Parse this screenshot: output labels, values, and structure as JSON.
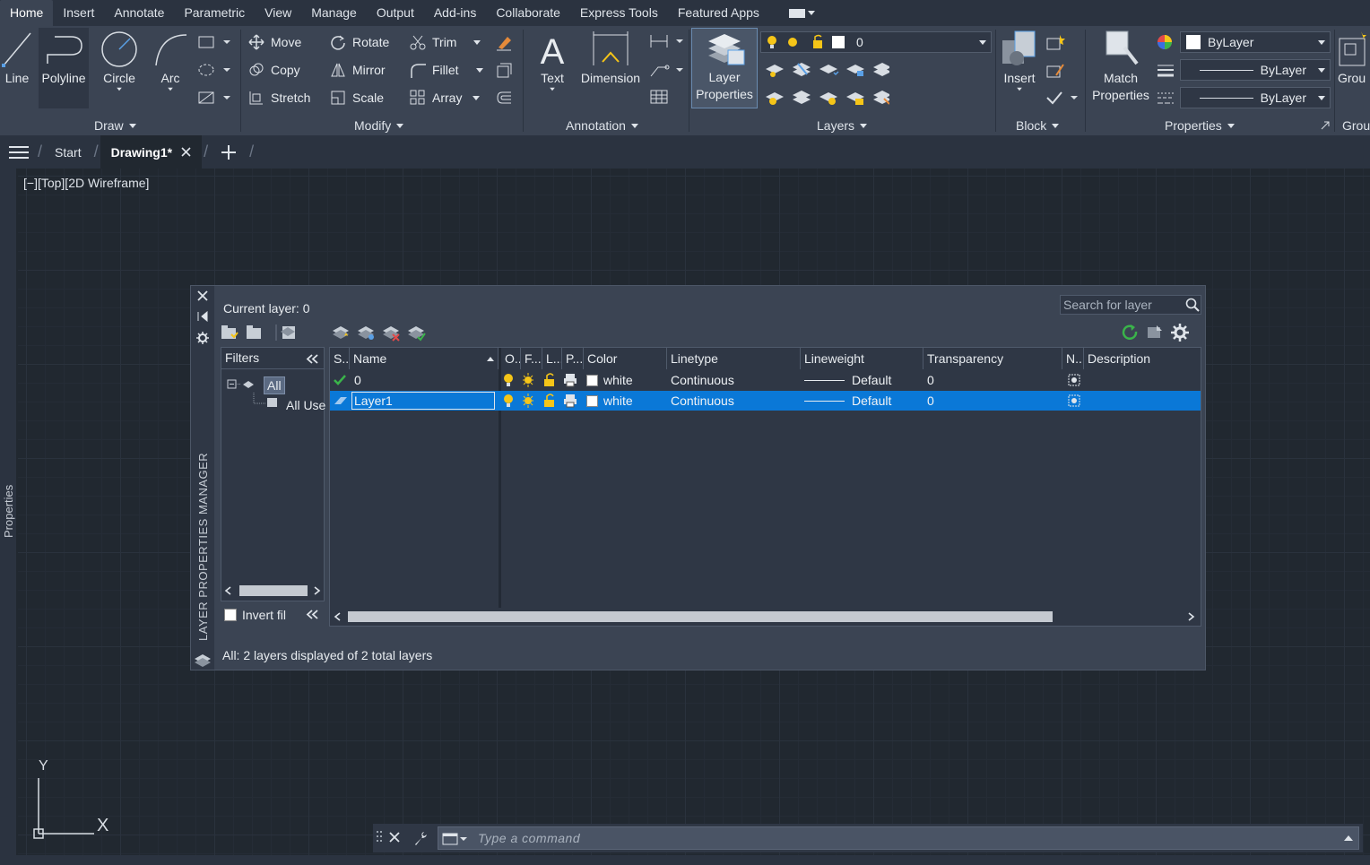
{
  "menu": {
    "items": [
      "Home",
      "Insert",
      "Annotate",
      "Parametric",
      "View",
      "Manage",
      "Output",
      "Add-ins",
      "Collaborate",
      "Express Tools",
      "Featured Apps"
    ]
  },
  "ribbon": {
    "draw": {
      "title": "Draw",
      "line": "Line",
      "polyline": "Polyline",
      "circle": "Circle",
      "arc": "Arc"
    },
    "modify": {
      "title": "Modify",
      "move": "Move",
      "rotate": "Rotate",
      "trim": "Trim",
      "copy": "Copy",
      "mirror": "Mirror",
      "fillet": "Fillet",
      "stretch": "Stretch",
      "scale": "Scale",
      "array": "Array"
    },
    "annotation": {
      "title": "Annotation",
      "text": "Text",
      "dimension": "Dimension"
    },
    "layers": {
      "title": "Layers",
      "layer_properties_1": "Layer",
      "layer_properties_2": "Properties",
      "current_layer": "0"
    },
    "block": {
      "title": "Block",
      "insert": "Insert"
    },
    "properties": {
      "title": "Properties",
      "match_1": "Match",
      "match_2": "Properties",
      "color": "ByLayer",
      "linetype": "ByLayer",
      "lineweight": "ByLayer"
    },
    "groups": {
      "title": "Grou",
      "group": "Grou"
    }
  },
  "filetabs": {
    "start": "Start",
    "drawing": "Drawing1*"
  },
  "viewport": {
    "label": "[−][Top][2D Wireframe]"
  },
  "sidebar": {
    "properties": "Properties"
  },
  "lpm": {
    "title": "LAYER PROPERTIES MANAGER",
    "current_layer": "Current layer: 0",
    "search_placeholder": "Search for layer",
    "filters_header": "Filters",
    "filter_all": "All",
    "filter_used": "All Use",
    "invert_filter": "Invert fil",
    "status": "All: 2 layers displayed of 2 total layers",
    "columns": [
      "S..",
      "Name",
      "O..",
      "F...",
      "L...",
      "P...",
      "Color",
      "Linetype",
      "Lineweight",
      "Transparency",
      "N..",
      "Description"
    ],
    "rows": [
      {
        "name": "0",
        "color": "white",
        "linetype": "Continuous",
        "lineweight": "Default",
        "transparency": "0",
        "description": "",
        "current": true,
        "selected": false
      },
      {
        "name": "Layer1",
        "color": "white",
        "linetype": "Continuous",
        "lineweight": "Default",
        "transparency": "0",
        "description": "",
        "current": false,
        "selected": true
      }
    ]
  },
  "ucs": {
    "x": "X",
    "y": "Y"
  },
  "command": {
    "placeholder": "Type a command"
  },
  "colors": {
    "accent": "#0a78d7",
    "ribbon": "#3b4453",
    "canvas": "#212830",
    "bulb": "#f5c518"
  }
}
